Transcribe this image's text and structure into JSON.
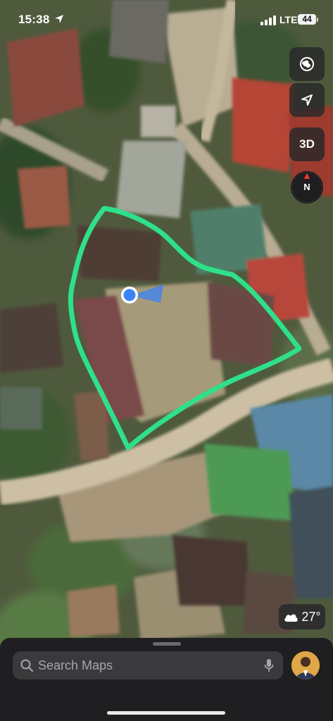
{
  "status_bar": {
    "time": "15:38",
    "network": "LTE",
    "battery": "44"
  },
  "map": {
    "type": "satellite",
    "overlay_color": "#2fe08a",
    "user_location_color": "#3b82f6"
  },
  "controls": {
    "globe_icon": "globe-icon",
    "location_icon": "location-arrow-icon",
    "three_d_label": "3D",
    "compass_label": "N"
  },
  "weather": {
    "temperature": "27°",
    "icon": "cloud-icon"
  },
  "search": {
    "placeholder": "Search Maps"
  }
}
